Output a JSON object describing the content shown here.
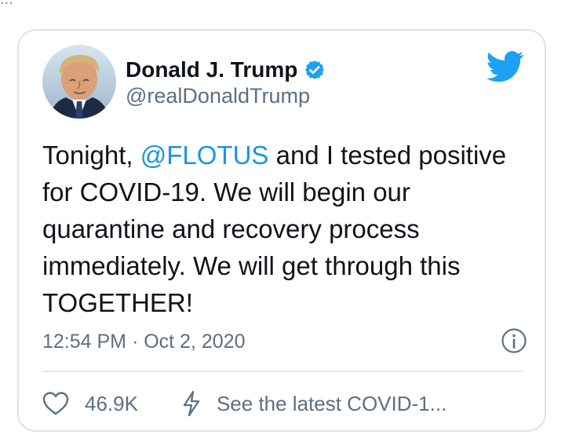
{
  "top_text": "...",
  "tweet": {
    "display_name": "Donald J. Trump",
    "handle": "@realDonaldTrump",
    "text_before": "Tonight, ",
    "mention": "@FLOTUS",
    "text_after": " and I tested positive for COVID-19. We will begin our quarantine and recovery process immediately. We will get through this TOGETHER!",
    "timestamp": "12:54 PM · Oct 2, 2020",
    "like_count": "46.9K",
    "covid_link_text": "See the latest COVID-1..."
  },
  "icons": {
    "verified": "verified-badge-icon",
    "twitter_logo": "twitter-bird-icon",
    "info": "info-icon",
    "like": "heart-outline-icon",
    "bolt": "lightning-bolt-icon"
  },
  "colors": {
    "brand_blue": "#1da1f2",
    "mention_blue": "#1b95e0",
    "secondary_text": "#5b7083",
    "primary_text": "#0f1419",
    "border": "#dfe4e8"
  }
}
